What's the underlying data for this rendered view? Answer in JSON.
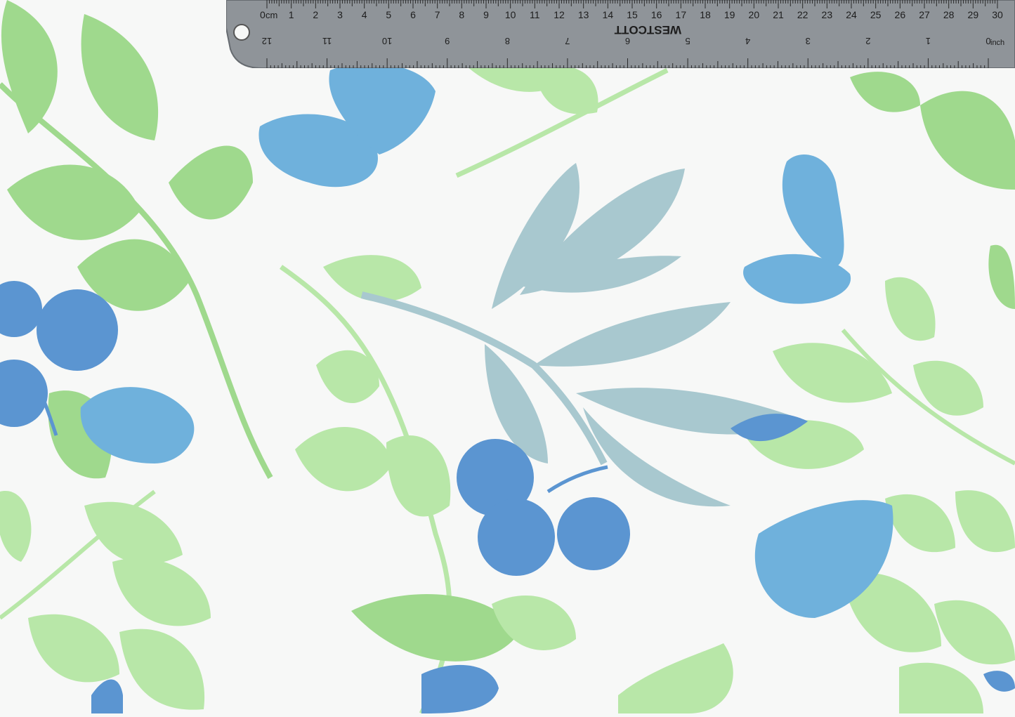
{
  "colors": {
    "background": "#f7f8f7",
    "leaf_green": "#9fd98d",
    "leaf_light_green": "#b8e7a8",
    "leaf_blue": "#6fb1dc",
    "berry_blue": "#5b95d1",
    "leaf_teal": "#a8c8cf",
    "ruler_metal": "#8f9499",
    "ruler_edge": "#666b70"
  },
  "ruler": {
    "brand": "WESTCOTT",
    "cm_label": "cm",
    "inch_label": "inch",
    "cm_marks": [
      "0",
      "1",
      "2",
      "3",
      "4",
      "5",
      "6",
      "7",
      "8",
      "9",
      "10",
      "11",
      "12",
      "13",
      "14",
      "15",
      "16",
      "17",
      "18",
      "19",
      "20",
      "21",
      "22",
      "23",
      "24",
      "25",
      "26",
      "27",
      "28",
      "29",
      "30"
    ],
    "inch_marks": [
      "12",
      "11",
      "10",
      "9",
      "8",
      "7",
      "6",
      "5",
      "4",
      "3",
      "2",
      "1",
      "0"
    ]
  }
}
